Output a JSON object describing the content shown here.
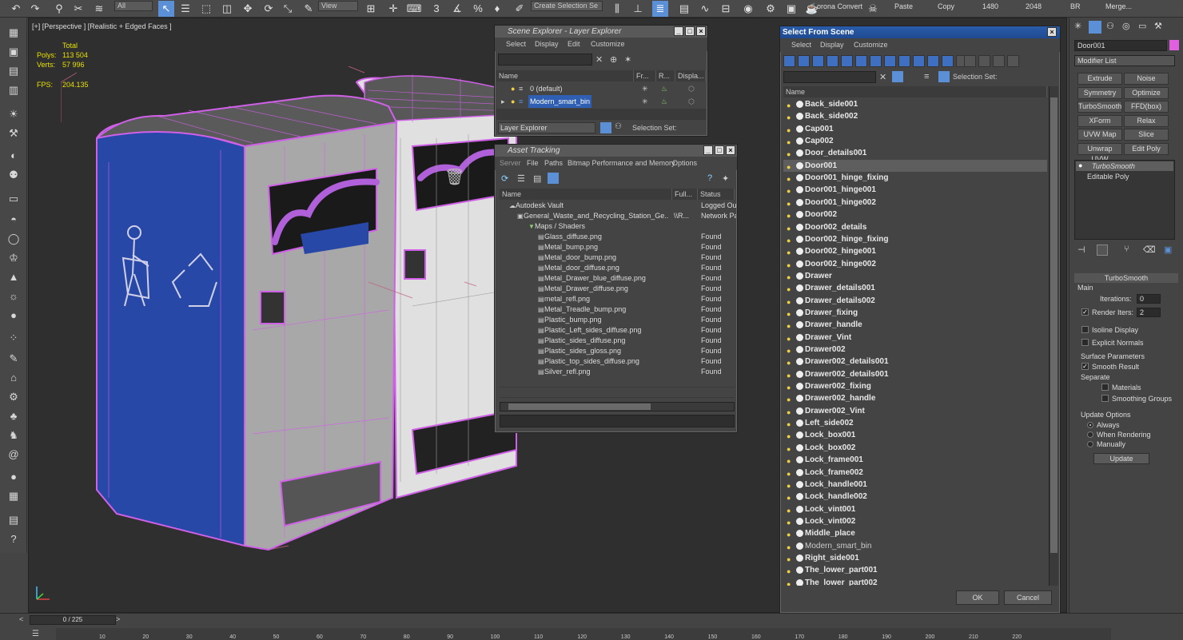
{
  "toolbar": {
    "select_filter": "All",
    "view_dropdown": "View",
    "named_selection": "Create Selection Se",
    "corona_label": "orona Convert",
    "paste_label": "Paste",
    "copy_label": "Copy",
    "num_1480": "1480",
    "num_2048": "2048",
    "br_label": "BR",
    "merge_label": "Merge..."
  },
  "viewport": {
    "label": "[+] [Perspective ] [Realistic + Edged Faces ]",
    "stats": {
      "total_label": "Total",
      "polys_label": "Polys:",
      "polys_value": "113 504",
      "verts_label": "Verts:",
      "verts_value": "57 996",
      "fps_label": "FPS:",
      "fps_value": "204.135"
    }
  },
  "scene_explorer": {
    "title": "Scene Explorer - Layer Explorer",
    "menu": [
      "Select",
      "Display",
      "Edit",
      "Customize"
    ],
    "columns": [
      "Name",
      "Fr...",
      "R...",
      "Displa..."
    ],
    "rows": [
      {
        "name": "0 (default)",
        "selected": false
      },
      {
        "name": "Modern_smart_bin",
        "selected": true
      }
    ],
    "footer_dropdown": "Layer Explorer",
    "selection_set_label": "Selection Set:"
  },
  "asset_tracking": {
    "title": "Asset Tracking",
    "menu": [
      "Server",
      "File",
      "Paths",
      "Bitmap Performance and Memory",
      "Options"
    ],
    "columns": [
      "Name",
      "Full...",
      "Status"
    ],
    "rows": [
      {
        "name": "Autodesk Vault",
        "full": "",
        "status": "Logged Out",
        "indent": 1
      },
      {
        "name": "General_Waste_and_Recycling_Station_Ge...",
        "full": "\\\\R...",
        "status": "Network Pa",
        "indent": 2
      },
      {
        "name": "Maps / Shaders",
        "full": "",
        "status": "",
        "indent": 3
      },
      {
        "name": "Glass_diffuse.png",
        "full": "",
        "status": "Found",
        "indent": 4
      },
      {
        "name": "Metal_bump.png",
        "full": "",
        "status": "Found",
        "indent": 4
      },
      {
        "name": "Metal_door_bump.png",
        "full": "",
        "status": "Found",
        "indent": 4
      },
      {
        "name": "Metal_door_diffuse.png",
        "full": "",
        "status": "Found",
        "indent": 4
      },
      {
        "name": "Metal_Drawer_blue_diffuse.png",
        "full": "",
        "status": "Found",
        "indent": 4
      },
      {
        "name": "Metal_Drawer_diffuse.png",
        "full": "",
        "status": "Found",
        "indent": 4
      },
      {
        "name": "metal_refl.png",
        "full": "",
        "status": "Found",
        "indent": 4
      },
      {
        "name": "Metal_Treadle_bump.png",
        "full": "",
        "status": "Found",
        "indent": 4
      },
      {
        "name": "Plastic_bump.png",
        "full": "",
        "status": "Found",
        "indent": 4
      },
      {
        "name": "Plastic_Left_sides_diffuse.png",
        "full": "",
        "status": "Found",
        "indent": 4
      },
      {
        "name": "Plastic_sides_diffuse.png",
        "full": "",
        "status": "Found",
        "indent": 4
      },
      {
        "name": "Plastic_sides_gloss.png",
        "full": "",
        "status": "Found",
        "indent": 4
      },
      {
        "name": "Plastic_top_sides_diffuse.png",
        "full": "",
        "status": "Found",
        "indent": 4
      },
      {
        "name": "Silver_refl.png",
        "full": "",
        "status": "Found",
        "indent": 4
      }
    ]
  },
  "select_from_scene": {
    "title": "Select From Scene",
    "menu": [
      "Select",
      "Display",
      "Customize"
    ],
    "selection_set_label": "Selection Set:",
    "column_name": "Name",
    "items": [
      {
        "name": "Back_side001",
        "selected": false,
        "group": false
      },
      {
        "name": "Back_side002",
        "selected": false,
        "group": false
      },
      {
        "name": "Cap001",
        "selected": false,
        "group": false
      },
      {
        "name": "Cap002",
        "selected": false,
        "group": false
      },
      {
        "name": "Door_details001",
        "selected": false,
        "group": false
      },
      {
        "name": "Door001",
        "selected": true,
        "group": false
      },
      {
        "name": "Door001_hinge_fixing",
        "selected": false,
        "group": false
      },
      {
        "name": "Door001_hinge001",
        "selected": false,
        "group": false
      },
      {
        "name": "Door001_hinge002",
        "selected": false,
        "group": false
      },
      {
        "name": "Door002",
        "selected": false,
        "group": false
      },
      {
        "name": "Door002_details",
        "selected": false,
        "group": false
      },
      {
        "name": "Door002_hinge_fixing",
        "selected": false,
        "group": false
      },
      {
        "name": "Door002_hinge001",
        "selected": false,
        "group": false
      },
      {
        "name": "Door002_hinge002",
        "selected": false,
        "group": false
      },
      {
        "name": "Drawer",
        "selected": false,
        "group": false
      },
      {
        "name": "Drawer_details001",
        "selected": false,
        "group": false
      },
      {
        "name": "Drawer_details002",
        "selected": false,
        "group": false
      },
      {
        "name": "Drawer_fixing",
        "selected": false,
        "group": false
      },
      {
        "name": "Drawer_handle",
        "selected": false,
        "group": false
      },
      {
        "name": "Drawer_Vint",
        "selected": false,
        "group": false
      },
      {
        "name": "Drawer002",
        "selected": false,
        "group": false
      },
      {
        "name": "Drawer002_details001",
        "selected": false,
        "group": false
      },
      {
        "name": "Drawer002_details001",
        "selected": false,
        "group": false
      },
      {
        "name": "Drawer002_fixing",
        "selected": false,
        "group": false
      },
      {
        "name": "Drawer002_handle",
        "selected": false,
        "group": false
      },
      {
        "name": "Drawer002_Vint",
        "selected": false,
        "group": false
      },
      {
        "name": "Left_side002",
        "selected": false,
        "group": false
      },
      {
        "name": "Lock_box001",
        "selected": false,
        "group": false
      },
      {
        "name": "Lock_box002",
        "selected": false,
        "group": false
      },
      {
        "name": "Lock_frame001",
        "selected": false,
        "group": false
      },
      {
        "name": "Lock_frame002",
        "selected": false,
        "group": false
      },
      {
        "name": "Lock_handle001",
        "selected": false,
        "group": false
      },
      {
        "name": "Lock_handle002",
        "selected": false,
        "group": false
      },
      {
        "name": "Lock_vint001",
        "selected": false,
        "group": false
      },
      {
        "name": "Lock_vint002",
        "selected": false,
        "group": false
      },
      {
        "name": "Middle_place",
        "selected": false,
        "group": false
      },
      {
        "name": "Modern_smart_bin",
        "selected": false,
        "group": true
      },
      {
        "name": "Right_side001",
        "selected": false,
        "group": false
      },
      {
        "name": "The_lower_part001",
        "selected": false,
        "group": false
      },
      {
        "name": "The_lower_part002",
        "selected": false,
        "group": false
      }
    ],
    "ok_label": "OK",
    "cancel_label": "Cancel"
  },
  "command_panel": {
    "object_name": "Door001",
    "object_color": "#e060e0",
    "modifier_list": "Modifier List",
    "modifier_buttons": [
      "Extrude",
      "Noise",
      "Symmetry",
      "Optimize",
      "TurboSmooth",
      "FFD(box)",
      "XForm",
      "Relax",
      "UVW Map",
      "Slice",
      "Unwrap UVW",
      "Edit Poly"
    ],
    "stack": [
      "TurboSmooth",
      "Editable Poly"
    ],
    "rollout_title": "TurboSmooth",
    "main_label": "Main",
    "iterations_label": "Iterations:",
    "iterations_value": "0",
    "render_iters_label": "Render Iters:",
    "render_iters_value": "2",
    "isoline_label": "Isoline Display",
    "explicit_normals_label": "Explicit Normals",
    "surface_params_label": "Surface Parameters",
    "smooth_result_label": "Smooth Result",
    "separate_label": "Separate",
    "materials_label": "Materials",
    "smoothing_groups_label": "Smoothing Groups",
    "update_options_label": "Update Options",
    "always_label": "Always",
    "when_rendering_label": "When Rendering",
    "manually_label": "Manually",
    "update_button": "Update"
  },
  "timeline": {
    "frame_counter": "0 / 225",
    "ticks": [
      "10",
      "20",
      "30",
      "40",
      "50",
      "60",
      "70",
      "80",
      "90",
      "100",
      "110",
      "120",
      "130",
      "140",
      "150",
      "160",
      "170",
      "180",
      "190",
      "200",
      "210",
      "220"
    ]
  },
  "colors": {
    "accent_blue": "#2f5fb3",
    "wire_magenta": "#d060e8",
    "bin_blue": "#2848a8",
    "stats_yellow": "#e8e000"
  }
}
